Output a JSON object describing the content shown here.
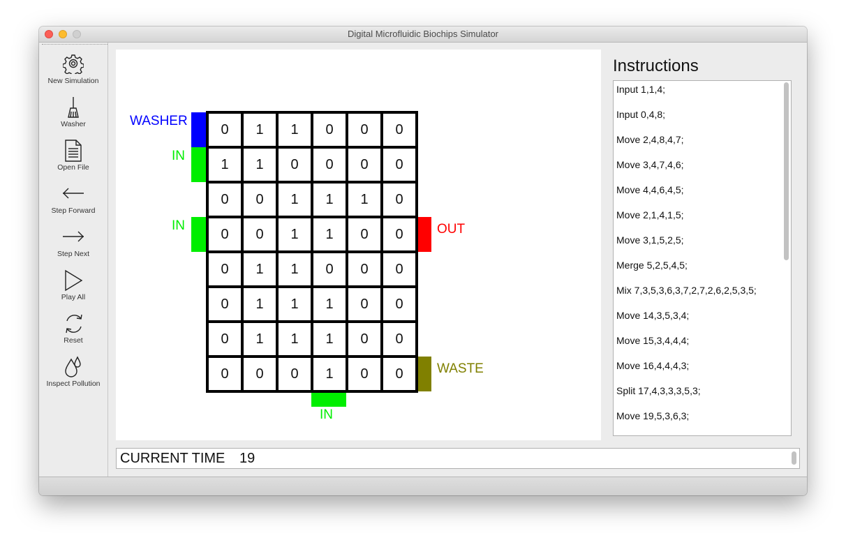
{
  "window": {
    "title": "Digital Microfluidic Biochips Simulator"
  },
  "toolbar": {
    "items": [
      {
        "label": "New Simulation",
        "icon": "gear-icon"
      },
      {
        "label": "Washer",
        "icon": "broom-icon"
      },
      {
        "label": "Open File",
        "icon": "document-icon"
      },
      {
        "label": "Step Forward",
        "icon": "arrow-left-icon"
      },
      {
        "label": "Step Next",
        "icon": "arrow-right-icon"
      },
      {
        "label": "Play All",
        "icon": "play-icon"
      },
      {
        "label": "Reset",
        "icon": "refresh-icon"
      },
      {
        "label": "Inspect Pollution",
        "icon": "droplets-icon"
      }
    ]
  },
  "biochip": {
    "grid": [
      [
        0,
        1,
        1,
        0,
        0,
        0
      ],
      [
        1,
        1,
        0,
        0,
        0,
        0
      ],
      [
        0,
        0,
        1,
        1,
        1,
        0
      ],
      [
        0,
        0,
        1,
        1,
        0,
        0
      ],
      [
        0,
        1,
        1,
        0,
        0,
        0
      ],
      [
        0,
        1,
        1,
        1,
        0,
        0
      ],
      [
        0,
        1,
        1,
        1,
        0,
        0
      ],
      [
        0,
        0,
        0,
        1,
        0,
        0
      ]
    ],
    "ports": {
      "washer": {
        "label": "WASHER",
        "color": "#0000ff"
      },
      "in_left_1": {
        "label": "IN",
        "color": "#00ee00"
      },
      "in_left_2": {
        "label": "IN",
        "color": "#00ee00"
      },
      "out": {
        "label": "OUT",
        "color": "#ff0000"
      },
      "waste": {
        "label": "WASTE",
        "color": "#808000"
      },
      "in_bottom": {
        "label": "IN",
        "color": "#00ee00"
      }
    }
  },
  "instructions": {
    "title": "Instructions",
    "items": [
      "Input 1,1,4;",
      "Input 0,4,8;",
      "Move 2,4,8,4,7;",
      "Move 3,4,7,4,6;",
      "Move 4,4,6,4,5;",
      "Move 2,1,4,1,5;",
      "Move 3,1,5,2,5;",
      "Merge 5,2,5,4,5;",
      "Mix 7,3,5,3,6,3,7,2,7,2,6,2,5,3,5;",
      "Move 14,3,5,3,4;",
      "Move 15,3,4,4,4;",
      "Move 16,4,4,4,3;",
      "Split 17,4,3,3,3,5,3;",
      "Move 19,5,3,6,3;"
    ]
  },
  "status": {
    "time_label": "CURRENT TIME",
    "time_value": "19"
  }
}
